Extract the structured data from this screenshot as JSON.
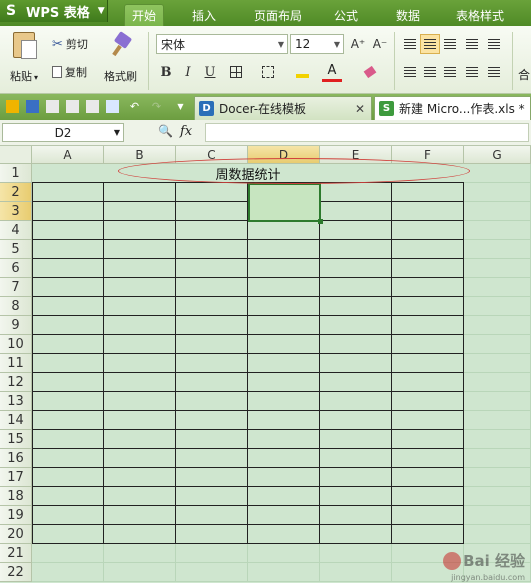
{
  "app": {
    "name": "WPS 表格"
  },
  "menu": {
    "tabs": [
      "开始",
      "插入",
      "页面布局",
      "公式",
      "数据",
      "表格样式"
    ],
    "active_index": 0
  },
  "ribbon": {
    "paste": "粘贴",
    "paste_arrow": "▾",
    "cut": "剪切",
    "copy": "复制",
    "format_painter": "格式刷",
    "font_name": "宋体",
    "font_size": "12",
    "grow_font": "A⁺",
    "shrink_font": "A⁻",
    "bold": "B",
    "italic": "I",
    "underline": "U",
    "truncated": "合"
  },
  "doc_tabs": [
    {
      "label": "Docer-在线模板",
      "icon_text": "D",
      "icon_color": "#2a6fb8",
      "active": false
    },
    {
      "label": "新建 Micro...作表.xls *",
      "icon_text": "S",
      "icon_color": "#3d9a3d",
      "active": true
    }
  ],
  "formula_bar": {
    "cell_ref": "D2",
    "fx_label": "fx",
    "search_icon": "🔍",
    "value": ""
  },
  "grid": {
    "columns": [
      "A",
      "B",
      "C",
      "D",
      "E",
      "F",
      "G"
    ],
    "rows": [
      "1",
      "2",
      "3",
      "4",
      "5",
      "6",
      "7",
      "8",
      "9",
      "10",
      "11",
      "12",
      "13",
      "14",
      "15",
      "16",
      "17",
      "18",
      "19",
      "20",
      "21",
      "22"
    ],
    "selected_column": "D",
    "selected_rows": [
      "2",
      "3"
    ],
    "title_text": "周数据统计",
    "active_cell": "D2"
  },
  "watermark": {
    "text": "Bai 经验",
    "url": "jingyan.baidu.com"
  },
  "colors": {
    "accent_green": "#4f8a26",
    "sheet_bg": "#cfe6cf",
    "highlight_oval": "#d0413c",
    "selection": "#2d7a2d"
  }
}
